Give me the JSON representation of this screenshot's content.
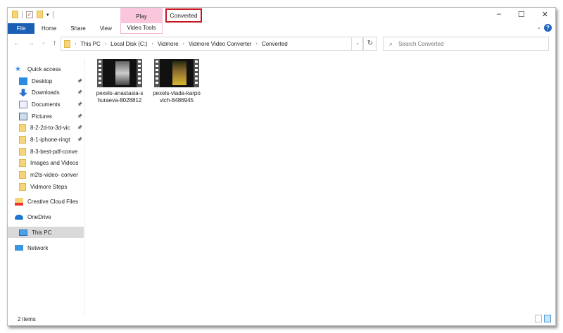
{
  "window": {
    "title": "Converted",
    "context_tab": "Play",
    "minimize": "–",
    "maximize": "☐",
    "close": "✕",
    "help": "?",
    "collapse": "⌄"
  },
  "ribbon": {
    "tabs": [
      "File",
      "Home",
      "Share",
      "View"
    ],
    "context_subtab": "Video Tools"
  },
  "nav": {
    "back": "←",
    "forward": "→",
    "recent": "⌄",
    "up": "↑"
  },
  "address": {
    "crumbs": [
      "This PC",
      "Local Disk (C:)",
      "Vidmore",
      "Vidmore Video Converter",
      "Converted"
    ],
    "separator": "›",
    "dropdown": "⌄",
    "refresh": "↻"
  },
  "search": {
    "placeholder": "Search Converted",
    "icon": "⌕"
  },
  "sidebar": {
    "quick_access": "Quick access",
    "items": [
      {
        "label": "Desktop",
        "icon": "desktop-icon",
        "pinned": true
      },
      {
        "label": "Downloads",
        "icon": "downloads-icon",
        "pinned": true
      },
      {
        "label": "Documents",
        "icon": "documents-icon",
        "pinned": true
      },
      {
        "label": "Pictures",
        "icon": "pictures-icon",
        "pinned": true
      },
      {
        "label": "8-2-2d-to-3d-vic",
        "icon": "folder-icon",
        "pinned": true
      },
      {
        "label": "8-1-iphone-ringt",
        "icon": "folder-icon",
        "pinned": true
      },
      {
        "label": "8-3-best-pdf-conve",
        "icon": "folder-icon",
        "pinned": false
      },
      {
        "label": "Images and Videos",
        "icon": "folder-icon",
        "pinned": false
      },
      {
        "label": "m2ts-video- conver",
        "icon": "folder-icon",
        "pinned": false
      },
      {
        "label": "Vidmore Steps",
        "icon": "folder-icon",
        "pinned": false
      }
    ],
    "creative_cloud": "Creative Cloud Files",
    "onedrive": "OneDrive",
    "this_pc": "This PC",
    "network": "Network",
    "pin_glyph": "📌"
  },
  "files": [
    {
      "name": "pexels-anastasia-shuraeva-8028812"
    },
    {
      "name": "pexels-vlada-karpovich-8486945"
    }
  ],
  "status": {
    "count": "2 items"
  },
  "colors": {
    "accent": "#1a5fb4",
    "context_tab": "#f9c6dc",
    "highlight": "#c8161d"
  }
}
